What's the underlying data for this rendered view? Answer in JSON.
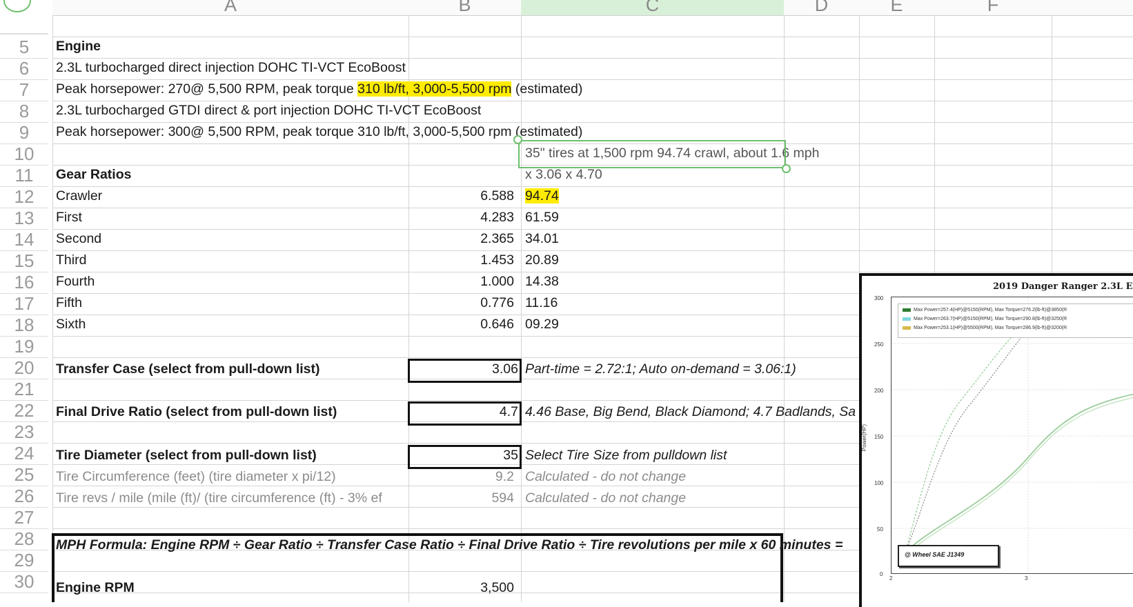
{
  "columns": [
    "A",
    "B",
    "C",
    "D",
    "E",
    "F"
  ],
  "rows": [
    "5",
    "6",
    "7",
    "8",
    "9",
    "10",
    "11",
    "12",
    "13",
    "14",
    "15",
    "16",
    "17",
    "18",
    "19",
    "20",
    "21",
    "22",
    "23",
    "24",
    "25",
    "26",
    "27",
    "28",
    "29",
    "30"
  ],
  "cells": {
    "a5": "Engine",
    "a6": "2.3L turbocharged direct injection DOHC TI-VCT EcoBoost",
    "a7_pre": "Peak horsepower: 270@ 5,500 RPM, peak torque ",
    "a7_hl": "310 lb/ft, 3,000-5,500 rpm",
    "a7_post": " (estimated)",
    "a8": "2.3L turbocharged GTDI direct & port injection DOHC TI-VCT EcoBoost",
    "a9": "Peak horsepower: 300@ 5,500 RPM, peak torque 310 lb/ft, 3,000-5,500 rpm (estimated)",
    "c10": "35\" tires at 1,500 rpm  94.74 crawl, about 1.6 mph",
    "a11": "Gear Ratios",
    "c11": "x 3.06 x 4.70",
    "gears": [
      {
        "name": "Crawler",
        "ratio": "6.588",
        "value": "94.74"
      },
      {
        "name": "First",
        "ratio": "4.283",
        "value": "61.59"
      },
      {
        "name": "Second",
        "ratio": "2.365",
        "value": "34.01"
      },
      {
        "name": "Third",
        "ratio": "1.453",
        "value": "20.89"
      },
      {
        "name": "Fourth",
        "ratio": "1.000",
        "value": "14.38"
      },
      {
        "name": "Fifth",
        "ratio": "0.776",
        "value": "11.16"
      },
      {
        "name": "Sixth",
        "ratio": "0.646",
        "value": "09.29"
      }
    ],
    "a20": "Transfer Case (select from pull-down list)",
    "b20": "3.06",
    "c20": "Part-time = 2.72:1; Auto on-demand = 3.06:1)",
    "a22": "Final Drive Ratio (select from pull-down list)",
    "b22": "4.7",
    "c22": "4.46 Base, Big Bend, Black Diamond; 4.7 Badlands, Sa",
    "a24": "Tire Diameter (select from pull-down list)",
    "b24": "35",
    "c24": "Select Tire Size from pulldown list",
    "a25": "Tire Circumference (feet) (tire diameter x pi/12)",
    "b25": "9.2",
    "c25": "Calculated - do not change",
    "a26": "Tire revs / mile (mile (ft)/ (tire circumference (ft) - 3% ef",
    "b26": "594",
    "c26": "Calculated - do not change",
    "a28": "MPH Formula: Engine RPM ÷ Gear Ratio  ÷ Transfer Case Ratio  ÷ Final Drive Ratio  ÷ Tire revolutions per mile x 60 minutes = ",
    "a30": "Engine RPM",
    "b30": "3,500"
  },
  "chart": {
    "title": "2019 Danger Ranger 2.3L E",
    "y_ticks": [
      "300",
      "250",
      "200",
      "150",
      "100",
      "50",
      "0"
    ],
    "x_ticks": [
      "2",
      "3"
    ],
    "y_axis_label": "Power(HP)",
    "legend": [
      {
        "label": "Max Power=257.4(HP)@5150(RPM), Max Torque=276.2(lb-ft)@3850(R",
        "color": "#2e7d32"
      },
      {
        "label": "Max Power=263.7(HP)@5150(RPM), Max Torque=290.8(lb-ft)@3250(R",
        "color": "#7fd8e0"
      },
      {
        "label": "Max Power=253.1(HP)@5500(RPM), Max Torque=286.9(lb-ft)@3200(R",
        "color": "#d8b94a"
      }
    ],
    "standard": "@ Wheel SAE J1349"
  }
}
